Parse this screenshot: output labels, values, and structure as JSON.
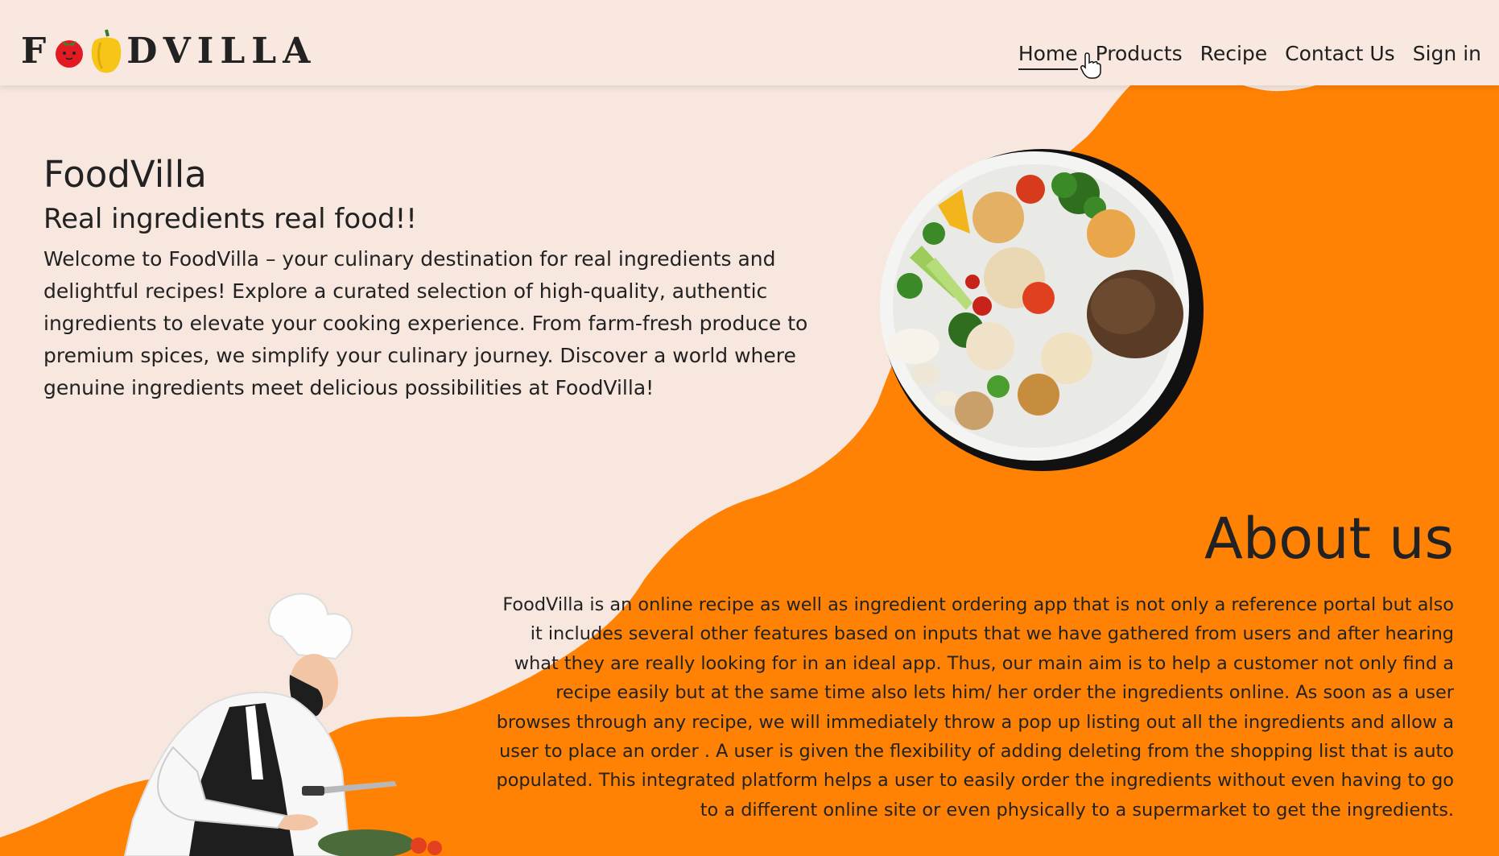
{
  "brand": {
    "logo_text_left": "F",
    "logo_text_right": "DVILLA"
  },
  "nav": {
    "items": [
      {
        "label": "Home",
        "active": true
      },
      {
        "label": "Products",
        "active": false
      },
      {
        "label": "Recipe",
        "active": false
      },
      {
        "label": "Contact Us",
        "active": false
      },
      {
        "label": "Sign in",
        "active": false
      }
    ]
  },
  "hero": {
    "title": "FoodVilla",
    "subtitle": "Real ingredients real food!!",
    "description": "Welcome to FoodVilla – your culinary destination for real ingredients and delightful recipes! Explore a curated selection of high-quality, authentic ingredients to elevate your cooking experience. From farm-fresh produce to premium spices, we simplify your culinary journey. Discover a world where genuine ingredients meet delicious possibilities at FoodVilla!"
  },
  "about": {
    "title": "About us",
    "text": "FoodVilla is an online recipe as well as ingredient ordering app that is not only a reference portal but also it includes several other features based on inputs that we have gathered from users and after hearing what they are really looking for in an ideal app. Thus, our main aim is to help a customer not only find a recipe easily but at the same time also lets him/ her order the ingredients online. As soon as a user browses through any recipe, we will immediately throw a pop up listing out all the ingredients and allow a user to place an order . A user is given the flexibility of adding deleting from the shopping list that is auto populated. This integrated platform helps a user to easily order the ingredients without even having to go to a different online site or even physically to a supermarket to get the ingredients."
  },
  "colors": {
    "background": "#f7e7de",
    "accent_orange": "#ff8204",
    "text": "#222222"
  },
  "icons": [
    "tomato-icon",
    "bell-pepper-icon",
    "pointer-cursor-icon"
  ]
}
